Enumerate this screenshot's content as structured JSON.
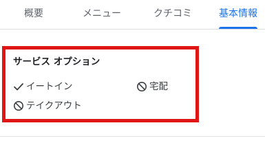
{
  "tabs": [
    {
      "label": "概要"
    },
    {
      "label": "メニュー"
    },
    {
      "label": "クチコミ"
    },
    {
      "label": "基本情報",
      "active": true
    }
  ],
  "section": {
    "title": "サービス オプション",
    "options": [
      {
        "label": "イートイン",
        "status": "available",
        "icon": "check-icon"
      },
      {
        "label": "宅配",
        "status": "unavailable",
        "icon": "prohibited-icon"
      },
      {
        "label": "テイクアウト",
        "status": "unavailable",
        "icon": "prohibited-icon"
      }
    ]
  },
  "colors": {
    "accent": "#1a73e8",
    "highlight": "#e01515"
  }
}
